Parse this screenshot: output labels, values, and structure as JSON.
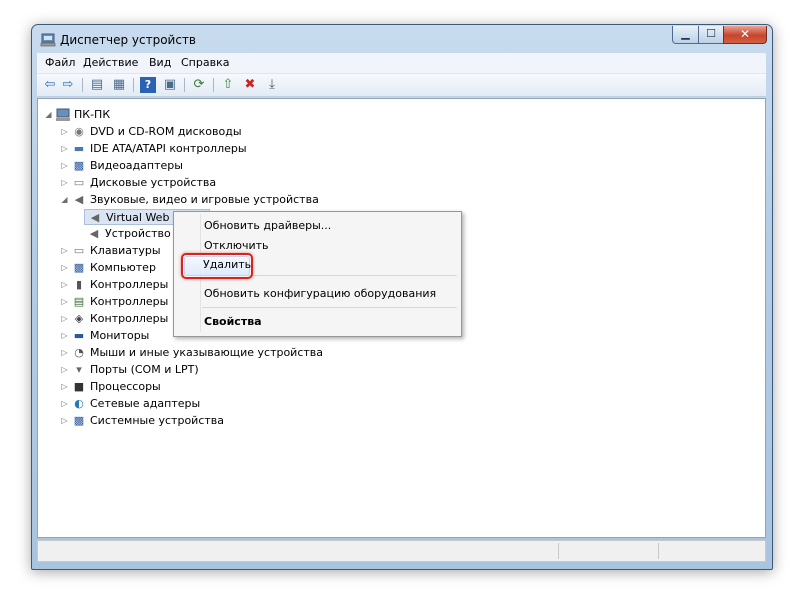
{
  "window": {
    "title": "Диспетчер устройств",
    "minimize_glyph": "▁",
    "maximize_glyph": "☐",
    "close_glyph": "✕"
  },
  "menu": [
    "Файл",
    "Действие",
    "Вид",
    "Справка"
  ],
  "toolbar": [
    {
      "icon": "back-arrow-icon",
      "glyph": "⇦"
    },
    {
      "icon": "forward-arrow-icon",
      "glyph": "⇨"
    },
    {
      "icon": "show-hide-console-tree-icon",
      "glyph": "▤"
    },
    {
      "icon": "properties-icon",
      "glyph": "▦"
    },
    {
      "icon": "help-icon",
      "glyph": "?"
    },
    {
      "icon": "view-icon",
      "glyph": "▣"
    },
    {
      "icon": "scan-hardware-icon",
      "glyph": "⟳"
    },
    {
      "icon": "update-driver-icon",
      "glyph": "⇧"
    },
    {
      "icon": "uninstall-icon",
      "glyph": "✖"
    },
    {
      "icon": "disable-device-icon",
      "glyph": "⤓"
    }
  ],
  "tree": {
    "root": "ПК-ПК",
    "items": [
      {
        "label": "DVD и CD-ROM дисководы",
        "icon": "dvd-drive-icon",
        "glyph": "◉",
        "expander": "▷"
      },
      {
        "label": "IDE ATA/ATAPI контроллеры",
        "icon": "ide-controller-icon",
        "glyph": "▬",
        "expander": "▷"
      },
      {
        "label": "Видеоадаптеры",
        "icon": "display-adapter-icon",
        "glyph": "▩",
        "expander": "▷"
      },
      {
        "label": "Дисковые устройства",
        "icon": "disk-drive-icon",
        "glyph": "▭",
        "expander": "▷"
      },
      {
        "label": "Звуковые, видео и игровые устройства",
        "icon": "speaker-icon",
        "glyph": "◀",
        "expander": "◢"
      },
      {
        "label": "Virtual Web",
        "icon": "speaker-icon",
        "glyph": "◀",
        "expander": ""
      },
      {
        "label": "Устройство",
        "icon": "speaker-icon",
        "glyph": "◀",
        "expander": ""
      },
      {
        "label": "Клавиатуры",
        "icon": "keyboard-icon",
        "glyph": "▭",
        "expander": "▷"
      },
      {
        "label": "Компьютер",
        "icon": "computer-icon",
        "glyph": "▩",
        "expander": "▷"
      },
      {
        "label": "Контроллеры",
        "icon": "usb-controller-icon",
        "glyph": "▮",
        "expander": "▷"
      },
      {
        "label": "Контроллеры",
        "icon": "storage-controller-icon",
        "glyph": "▤",
        "expander": "▷"
      },
      {
        "label": "Контроллеры",
        "icon": "network-controller-icon",
        "glyph": "◈",
        "expander": "▷"
      },
      {
        "label": "Мониторы",
        "icon": "monitor-icon",
        "glyph": "▬",
        "expander": "▷"
      },
      {
        "label": "Мыши и иные указывающие устройства",
        "icon": "mouse-icon",
        "glyph": "◔",
        "expander": "▷"
      },
      {
        "label": "Порты (COM и LPT)",
        "icon": "port-icon",
        "glyph": "▾",
        "expander": "▷"
      },
      {
        "label": "Процессоры",
        "icon": "processor-icon",
        "glyph": "■",
        "expander": "▷"
      },
      {
        "label": "Сетевые адаптеры",
        "icon": "network-adapter-icon",
        "glyph": "◐",
        "expander": "▷"
      },
      {
        "label": "Системные устройства",
        "icon": "system-device-icon",
        "glyph": "▩",
        "expander": "▷"
      }
    ]
  },
  "context_menu": {
    "update": "Обновить драйверы...",
    "disable": "Отключить",
    "uninstall": "Удалить",
    "scan": "Обновить конфигурацию оборудования",
    "properties": "Свойства"
  },
  "colors": {
    "highlight_border": "#d6231d",
    "window_frame": "#b3cde6"
  }
}
